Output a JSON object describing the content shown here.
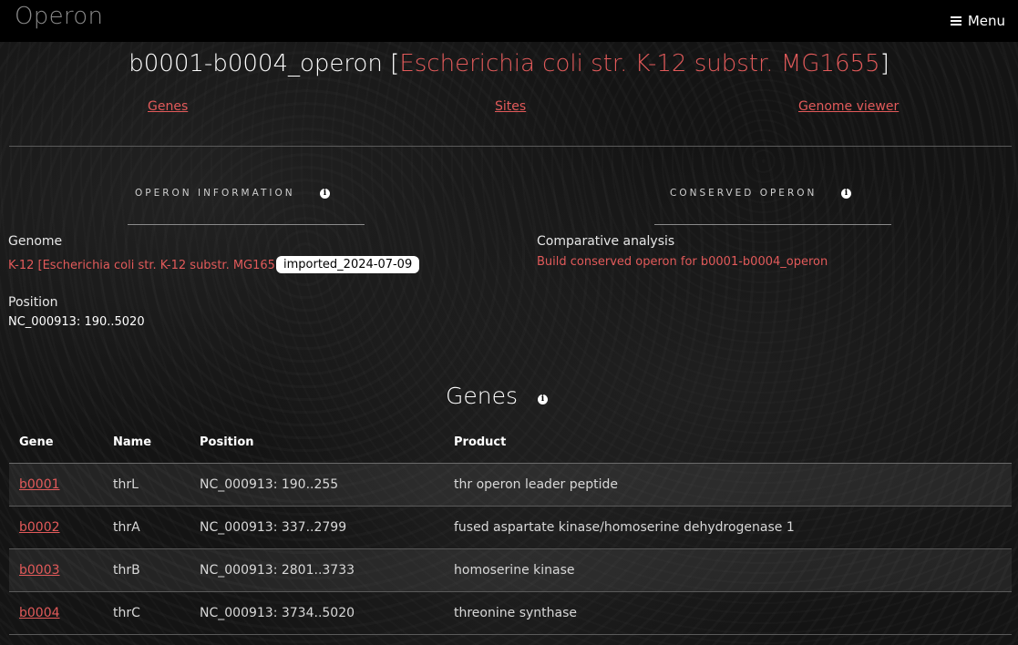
{
  "app": {
    "brand": "Operon",
    "menu_label": "Menu"
  },
  "page": {
    "title_main": "b0001-b0004_operon",
    "title_bracket_open": "[",
    "title_organism": "Escherichia coli str. K-12 substr. MG1655",
    "title_bracket_close": "]"
  },
  "nav": {
    "genes": "Genes",
    "sites": "Sites",
    "genome_viewer": "Genome viewer"
  },
  "operon_info": {
    "heading": "OPERON INFORMATION",
    "genome_label": "Genome",
    "genome_link": "K-12 [Escherichia coli str. K-12 substr. MG1655]",
    "genome_badge": "imported_2024-07-09",
    "position_label": "Position",
    "position_value": "NC_000913: 190..5020"
  },
  "conserved": {
    "heading": "CONSERVED OPERON",
    "comparative_label": "Comparative analysis",
    "build_link": "Build conserved operon for b0001-b0004_operon"
  },
  "genes_section": {
    "title": "Genes",
    "columns": {
      "gene": "Gene",
      "name": "Name",
      "position": "Position",
      "product": "Product"
    },
    "rows": [
      {
        "gene": "b0001",
        "name": "thrL",
        "position": "NC_000913: 190..255",
        "product": "thr operon leader peptide"
      },
      {
        "gene": "b0002",
        "name": "thrA",
        "position": "NC_000913: 337..2799",
        "product": "fused aspartate kinase/homoserine dehydrogenase 1"
      },
      {
        "gene": "b0003",
        "name": "thrB",
        "position": "NC_000913: 2801..3733",
        "product": "homoserine kinase"
      },
      {
        "gene": "b0004",
        "name": "thrC",
        "position": "NC_000913: 3734..5020",
        "product": "threonine synthase"
      }
    ]
  },
  "icons": {
    "menu": "hamburger-icon",
    "info": "info-icon"
  },
  "colors": {
    "accent": "#e25a5a",
    "topbar": "#000000",
    "background": "#141414"
  }
}
